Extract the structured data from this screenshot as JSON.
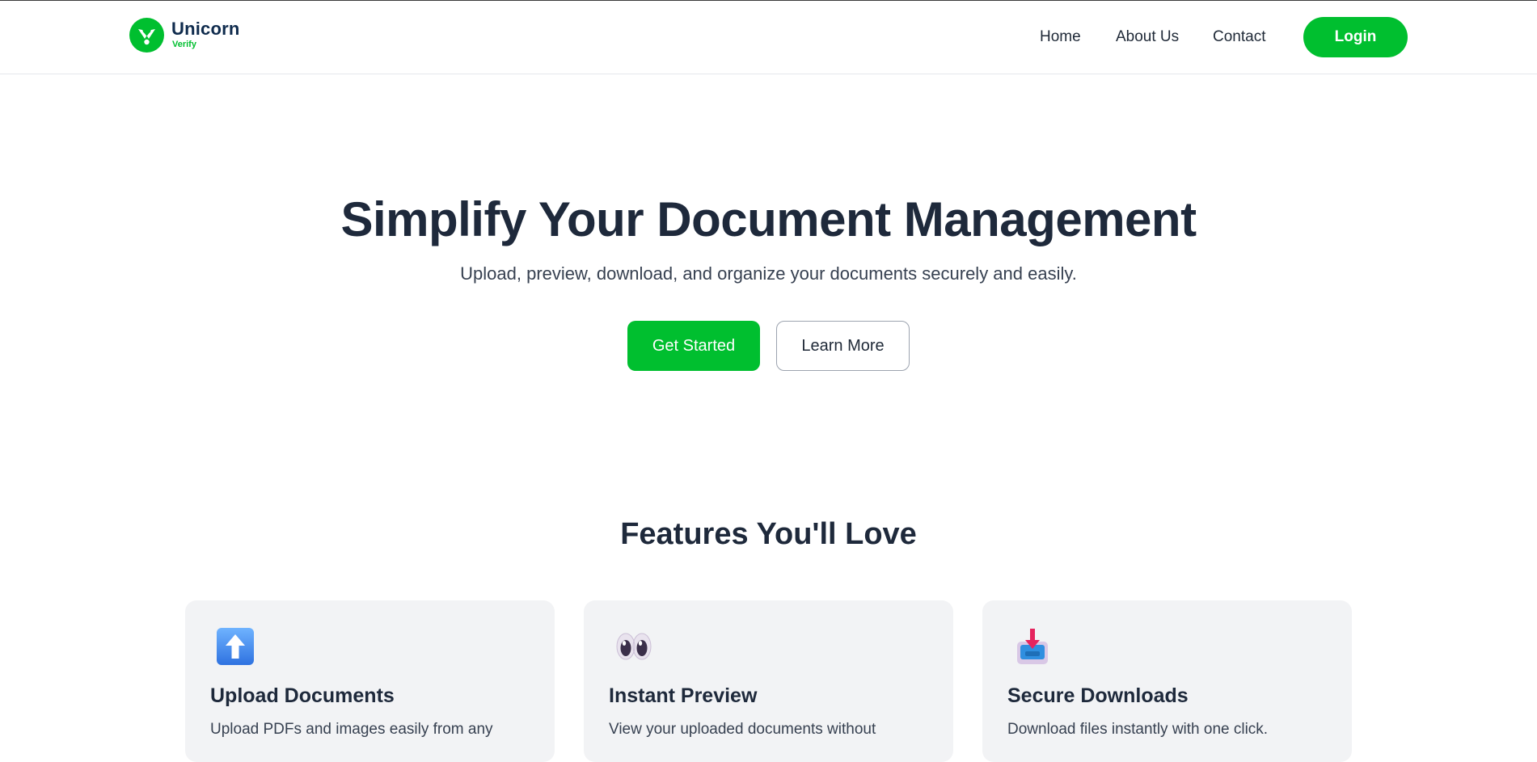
{
  "brand": {
    "name": "Unicorn",
    "sub": "Verify",
    "accent_color": "#00bf2f",
    "name_color": "#0f2b4d"
  },
  "nav": {
    "links": [
      "Home",
      "About Us",
      "Contact"
    ],
    "login_label": "Login"
  },
  "hero": {
    "title": "Simplify Your Document Management",
    "subtitle": "Upload, preview, download, and organize your documents securely and easily.",
    "primary_cta": "Get Started",
    "secondary_cta": "Learn More"
  },
  "features": {
    "heading": "Features You'll Love",
    "cards": [
      {
        "icon": "up-arrow-icon",
        "title": "Upload Documents",
        "description": "Upload PDFs and images easily from any"
      },
      {
        "icon": "eyes-icon",
        "title": "Instant Preview",
        "description": "View your uploaded documents without"
      },
      {
        "icon": "inbox-download-icon",
        "title": "Secure Downloads",
        "description": "Download files instantly with one click."
      }
    ]
  }
}
